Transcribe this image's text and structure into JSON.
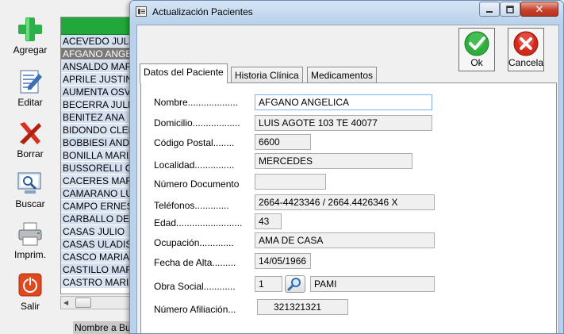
{
  "main": {
    "toolbar": [
      {
        "label": "Agregar",
        "icon": "plus-icon"
      },
      {
        "label": "Editar",
        "icon": "edit-document-icon"
      },
      {
        "label": "Borrar",
        "icon": "delete-x-icon"
      },
      {
        "label": "Buscar",
        "icon": "search-monitor-icon"
      },
      {
        "label": "Imprim.",
        "icon": "printer-icon"
      },
      {
        "label": "Salir",
        "icon": "power-icon"
      }
    ],
    "grid_rows": [
      "ACEVEDO JULIO",
      "AFGANO ANGELICA",
      "ANSALDO MARIA",
      "APRILE JUSTINA",
      "AUMENTA OSVALDO",
      "BECERRA JULIO",
      "BENITEZ ANA",
      "BIDONDO CLELIA",
      "BOBBIESI ANDREA",
      "BONILLA MARIA",
      "BUSSORELLI C",
      "CACERES MARIA",
      "CAMARANO LUIS",
      "CAMPO ERNESTO",
      "CARBALLO DE",
      "CASAS JULIO",
      "CASAS ULADISLAO",
      "CASCO MARIA",
      "CASTILLO MARIA",
      "CASTRO MARIA"
    ],
    "selected_row": 1,
    "search_label": "Nombre a Buscar"
  },
  "dialog": {
    "title": "Actualización Pacientes",
    "close_symbol": "✕",
    "buttons": {
      "ok": "Ok",
      "cancel": "Cancela"
    },
    "tabs": [
      "Datos del Paciente",
      "Historia Clínica",
      "Medicamentos"
    ],
    "active_tab": 0,
    "fields": {
      "nombre": {
        "label": "Nombre...................",
        "value": "AFGANO ANGELICA"
      },
      "domicilio": {
        "label": "Domicilio..................",
        "value": "LUIS AGOTE 103   TE 40077"
      },
      "codigo_postal": {
        "label": "Código Postal........",
        "value": "6600"
      },
      "localidad": {
        "label": "Localidad...............",
        "value": "MERCEDES"
      },
      "numero_documento": {
        "label": "Número Documento",
        "value": ""
      },
      "telefonos": {
        "label": "Teléfonos.............",
        "value": "2664-4423346 /  2664.4426346 X"
      },
      "edad": {
        "label": "Edad.........................",
        "value": "43"
      },
      "ocupacion": {
        "label": "Ocupación.............",
        "value": "AMA DE CASA"
      },
      "fecha_alta": {
        "label": "Fecha de Alta.........",
        "value": "14/05/1966"
      },
      "obra_social": {
        "label": "Obra Social............",
        "code": "1",
        "name": "PAMI"
      },
      "numero_afiliacion": {
        "label": "Número Afiliación...",
        "value": "321321321"
      }
    }
  },
  "colors": {
    "grid_header": "#22a83a",
    "grid_selected": "#7a7a7a",
    "dialog_frame": "#b9d1ea",
    "close_button": "#c7432d"
  }
}
